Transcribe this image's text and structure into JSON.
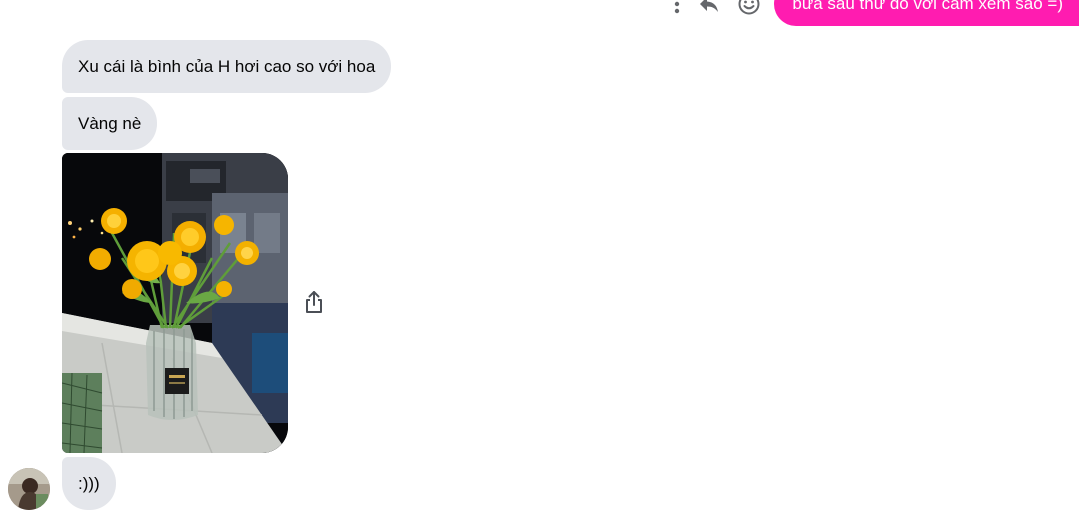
{
  "conversation": {
    "outgoing": {
      "text": "bữa sau thử đo với cắm xem sao =)",
      "bubble_color": "#ff1cb0",
      "actions": [
        "more-icon",
        "reply-icon",
        "emoji-icon"
      ]
    },
    "incoming": [
      {
        "text": "Xu cái là bình của H hơi cao so với hoa"
      },
      {
        "text": "Vàng nè"
      },
      {
        "text": ":)))"
      }
    ],
    "photo": {
      "subject": "yellow flowers in glass vase"
    },
    "share_icon": "share-icon",
    "incoming_bubble_color": "#e4e6eb"
  }
}
